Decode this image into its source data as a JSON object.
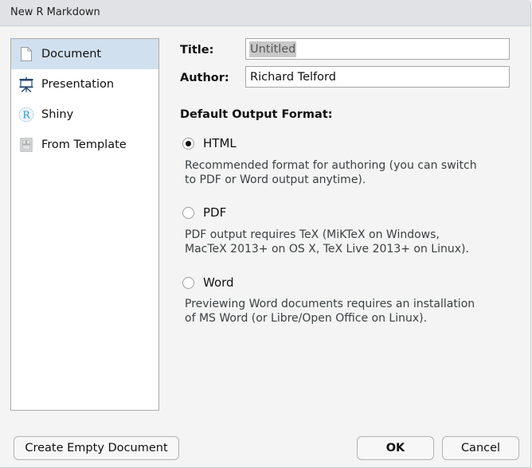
{
  "window": {
    "title": "New R Markdown"
  },
  "sidebar": {
    "items": [
      {
        "label": "Document",
        "icon": "document-icon",
        "selected": true
      },
      {
        "label": "Presentation",
        "icon": "presentation-easel-icon",
        "selected": false
      },
      {
        "label": "Shiny",
        "icon": "shiny-r-icon",
        "selected": false
      },
      {
        "label": "From Template",
        "icon": "template-icon",
        "selected": false
      }
    ]
  },
  "form": {
    "title_label": "Title:",
    "title_value": "Untitled",
    "author_label": "Author:",
    "author_value": "Richard Telford",
    "output_format_heading": "Default Output Format:"
  },
  "formats": [
    {
      "label": "HTML",
      "selected": true,
      "description_line1": "Recommended format for authoring (you can switch",
      "description_line2": "to PDF or Word output anytime)."
    },
    {
      "label": "PDF",
      "selected": false,
      "description_line1": "PDF output requires TeX (MiKTeX on Windows,",
      "description_line2": "MacTeX 2013+ on OS X, TeX Live 2013+ on Linux)."
    },
    {
      "label": "Word",
      "selected": false,
      "description_line1": "Previewing Word documents requires an installation",
      "description_line2": "of MS Word (or Libre/Open Office on Linux)."
    }
  ],
  "buttons": {
    "create_empty": "Create Empty Document",
    "ok": "OK",
    "cancel": "Cancel"
  }
}
